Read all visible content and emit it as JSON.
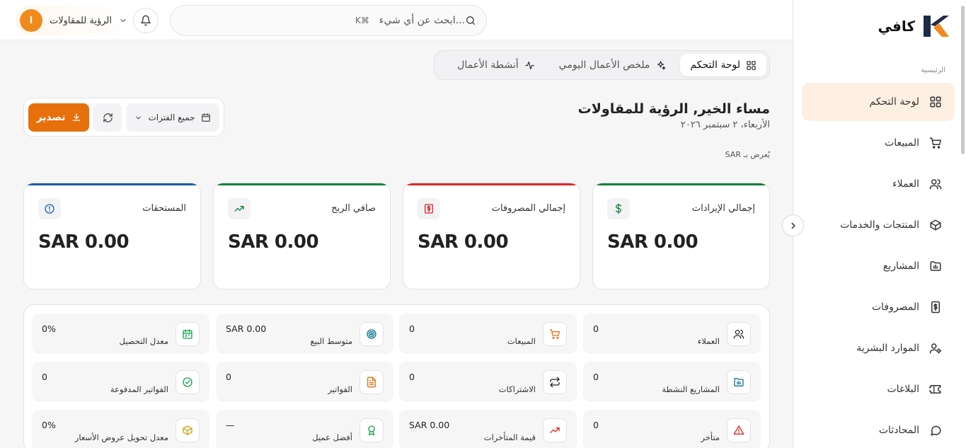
{
  "brand": {
    "name": "كافي"
  },
  "sidebar": {
    "section_label": "الرئيسية",
    "items": [
      {
        "label": "لوحة التحكم",
        "icon": "dashboard-icon",
        "active": true
      },
      {
        "label": "المبيعات",
        "icon": "cart-icon"
      },
      {
        "label": "العملاء",
        "icon": "users-icon"
      },
      {
        "label": "المنتجات والخدمات",
        "icon": "box-icon"
      },
      {
        "label": "المشاريع",
        "icon": "folder-chart-icon"
      },
      {
        "label": "المصروفات",
        "icon": "dollar-receipt-icon"
      },
      {
        "label": "الموارد البشرية",
        "icon": "user-settings-icon"
      },
      {
        "label": "البلاغات",
        "icon": "ticket-icon"
      },
      {
        "label": "المحادثات",
        "icon": "chat-icon"
      }
    ]
  },
  "topbar": {
    "search_placeholder": "...ابحث عن أي شيء",
    "search_shortcut": "⌘K",
    "user_name": "الرؤية للمقاولات",
    "user_initial": "ا"
  },
  "tabs": [
    {
      "label": "لوحة التحكم",
      "icon": "dashboard-icon",
      "active": true
    },
    {
      "label": "ملخص الأعمال اليومي",
      "icon": "sparkles-icon"
    },
    {
      "label": "أنشطة الأعمال",
      "icon": "activity-icon"
    }
  ],
  "greeting": {
    "title": "مساء الخير, الرؤية للمقاولات",
    "date": "الأربعاء، ٢ سبتمبر ٢٠٢٦",
    "currency_note": "يُعرض بـ SAR"
  },
  "controls": {
    "period_label": "جميع الفترات",
    "export_label": "تصدير"
  },
  "kpis": [
    {
      "title": "إجمالي الإيرادات",
      "value": "SAR 0.00",
      "accent": "#16803c",
      "icon": "dollar-icon"
    },
    {
      "title": "إجمالي المصروفات",
      "value": "SAR 0.00",
      "accent": "#dc2626",
      "icon": "receipt-dollar-icon"
    },
    {
      "title": "صافي الربح",
      "value": "SAR 0.00",
      "accent": "#16803c",
      "icon": "trend-up-icon"
    },
    {
      "title": "المستحقات",
      "value": "SAR 0.00",
      "accent": "#1d5fa8",
      "icon": "alert-circle-icon"
    }
  ],
  "metrics": [
    {
      "label": "العملاء",
      "value": "0",
      "icon": "users-icon",
      "color": "#333333"
    },
    {
      "label": "المبيعات",
      "value": "0",
      "icon": "cart-icon",
      "color": "#e8700c"
    },
    {
      "label": "متوسط البيع",
      "value": "SAR 0.00",
      "icon": "target-icon",
      "color": "#0e7490"
    },
    {
      "label": "معدل التحصيل",
      "value": "0%",
      "icon": "calendar-icon",
      "color": "#16a34a"
    },
    {
      "label": "المشاريع النشطة",
      "value": "0",
      "icon": "folder-chart-icon",
      "color": "#0e7490"
    },
    {
      "label": "الاشتراكات",
      "value": "0",
      "icon": "repeat-icon",
      "color": "#222222"
    },
    {
      "label": "الفواتير",
      "value": "0",
      "icon": "file-text-icon",
      "color": "#e8700c"
    },
    {
      "label": "الفواتير المدفوعة",
      "value": "0",
      "icon": "check-circle-icon",
      "color": "#16a34a"
    },
    {
      "label": "متأخر",
      "value": "0",
      "icon": "warning-icon",
      "color": "#dc2626"
    },
    {
      "label": "قيمة المتأخرات",
      "value": "SAR 0.00",
      "icon": "trend-up-icon",
      "color": "#dc2626"
    },
    {
      "label": "أفضل عميل",
      "value": "—",
      "icon": "award-icon",
      "color": "#16a34a"
    },
    {
      "label": "معدل تحويل عروض الأسعار",
      "value": "0%",
      "icon": "box-icon",
      "color": "#d4a017"
    }
  ]
}
